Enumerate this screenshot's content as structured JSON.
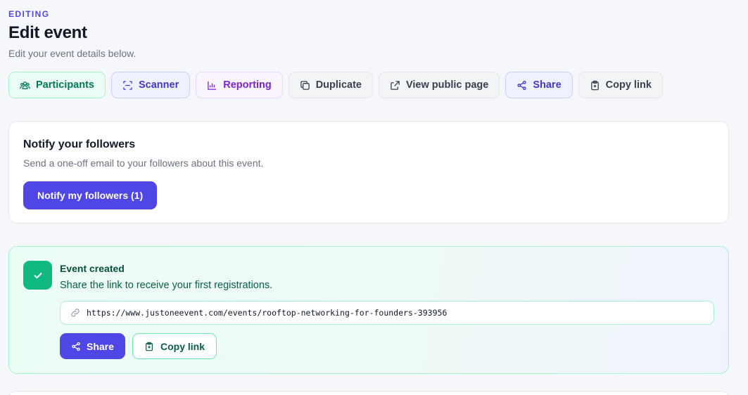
{
  "header": {
    "kicker": "EDITING",
    "title": "Edit event",
    "subtitle": "Edit your event details below."
  },
  "actions": [
    {
      "label": "Participants",
      "icon": "participants-icon"
    },
    {
      "label": "Scanner",
      "icon": "scan-icon"
    },
    {
      "label": "Reporting",
      "icon": "bar-chart-icon"
    },
    {
      "label": "Duplicate",
      "icon": "copy-icon"
    },
    {
      "label": "View public page",
      "icon": "external-link-icon"
    },
    {
      "label": "Share",
      "icon": "share-icon"
    },
    {
      "label": "Copy link",
      "icon": "clipboard-icon"
    }
  ],
  "notify": {
    "title": "Notify your followers",
    "description": "Send a one-off email to your followers about this event.",
    "button_label": "Notify my followers (1)"
  },
  "created": {
    "title": "Event created",
    "description": "Share the link to receive your first registrations.",
    "url": "https://www.justoneevent.com/events/rooftop-networking-for-founders-393956",
    "share_label": "Share",
    "copy_label": "Copy link"
  },
  "colors": {
    "accent": "#4f46e5",
    "success": "#10b981",
    "participants": "#047857",
    "reporting": "#7e22ce"
  }
}
